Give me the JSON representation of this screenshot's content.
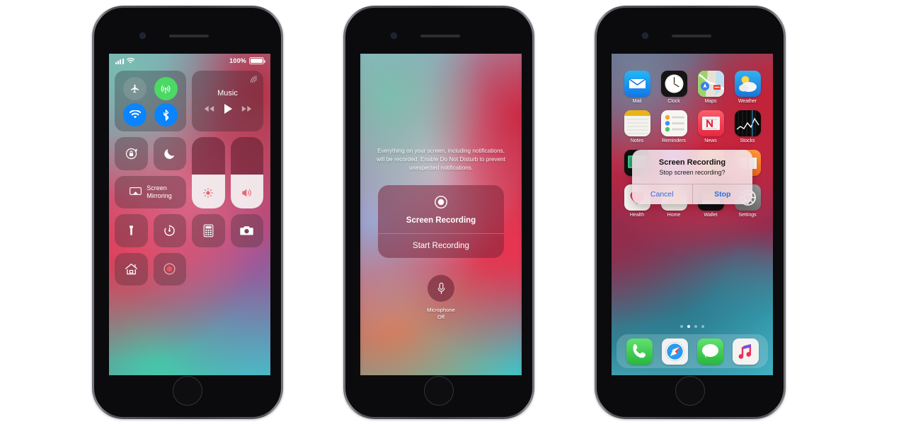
{
  "phones": [
    {
      "id": "phone-control-center",
      "status_bar": {
        "carrier_signal": "signal-bars-icon",
        "wifi": "wifi-icon",
        "battery_percent": "100%"
      },
      "control_center": {
        "connectivity": [
          {
            "name": "airplane-mode",
            "icon": "airplane-icon",
            "state": "off",
            "color": "#96a5aa"
          },
          {
            "name": "cellular-data",
            "icon": "cellular-icon",
            "state": "on",
            "color": "#4cd864"
          },
          {
            "name": "wifi",
            "icon": "wifi-icon",
            "state": "on",
            "color": "#0a84ff"
          },
          {
            "name": "bluetooth",
            "icon": "bluetooth-icon",
            "state": "on",
            "color": "#0a84ff"
          }
        ],
        "music": {
          "label": "Music",
          "airplay": "airplay-icon",
          "controls": [
            "rewind-icon",
            "play-icon",
            "fast-forward-icon"
          ]
        },
        "rotation_lock": {
          "name": "rotation-lock",
          "icon": "rotation-lock-icon"
        },
        "do_not_disturb": {
          "name": "do-not-disturb",
          "icon": "moon-icon"
        },
        "screen_mirroring": {
          "label_line1": "Screen",
          "label_line2": "Mirroring",
          "icon": "screen-mirroring-icon"
        },
        "brightness": {
          "name": "brightness-slider",
          "icon": "brightness-icon",
          "value": 48
        },
        "volume": {
          "name": "volume-slider",
          "icon": "volume-icon",
          "value": 48
        },
        "tools": [
          {
            "name": "flashlight",
            "icon": "flashlight-icon"
          },
          {
            "name": "timer",
            "icon": "timer-icon"
          },
          {
            "name": "calculator",
            "icon": "calculator-icon"
          },
          {
            "name": "camera",
            "icon": "camera-icon"
          },
          {
            "name": "home",
            "icon": "home-icon"
          },
          {
            "name": "screen-recording",
            "icon": "record-icon"
          }
        ]
      }
    },
    {
      "id": "phone-screen-recording-sheet",
      "sheet": {
        "description": "Everything on your screen, including notifications, will be recorded. Enable Do Not Disturb to prevent unexpected notifications.",
        "record_icon": "record-icon",
        "title": "Screen Recording",
        "action": "Start Recording",
        "microphone": {
          "icon": "microphone-icon",
          "label_line1": "Microphone",
          "label_line2": "Off"
        }
      }
    },
    {
      "id": "phone-home-screen-alert",
      "home_screen": {
        "rows": [
          [
            {
              "label": "Mail",
              "icon": "mail-icon"
            },
            {
              "label": "Clock",
              "icon": "clock-icon"
            },
            {
              "label": "Maps",
              "icon": "maps-icon"
            },
            {
              "label": "Weather",
              "icon": "weather-icon"
            }
          ],
          [
            {
              "label": "Notes",
              "icon": "notes-icon"
            },
            {
              "label": "Reminders",
              "icon": "reminders-icon"
            },
            {
              "label": "News",
              "icon": "news-icon"
            },
            {
              "label": "Stocks",
              "icon": "stocks-icon"
            }
          ],
          [
            {
              "label": "",
              "icon": "tv-icon"
            },
            {
              "label": "",
              "icon": "podcasts-icon"
            },
            {
              "label": "",
              "icon": "itunes-store-icon"
            },
            {
              "label": "",
              "icon": "books-icon"
            }
          ],
          [
            {
              "label": "Health",
              "icon": "health-icon"
            },
            {
              "label": "Home",
              "icon": "home-app-icon"
            },
            {
              "label": "Wallet",
              "icon": "wallet-icon"
            },
            {
              "label": "Settings",
              "icon": "settings-icon"
            }
          ]
        ],
        "page_dots": {
          "count": 4,
          "active_index": 1
        },
        "dock": [
          {
            "label": "Phone",
            "icon": "phone-icon"
          },
          {
            "label": "Safari",
            "icon": "safari-icon"
          },
          {
            "label": "Messages",
            "icon": "messages-icon"
          },
          {
            "label": "Music",
            "icon": "music-icon"
          }
        ]
      },
      "alert": {
        "title": "Screen Recording",
        "message": "Stop screen recording?",
        "cancel_label": "Cancel",
        "confirm_label": "Stop",
        "tint": "#2f6ddb"
      }
    }
  ]
}
